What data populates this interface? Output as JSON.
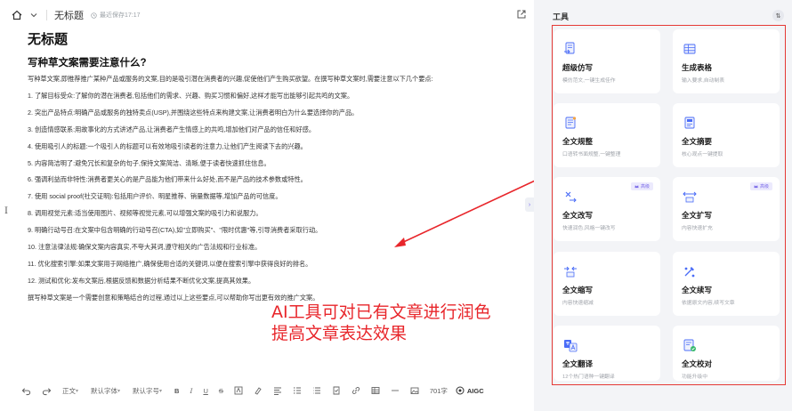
{
  "topbar": {
    "doc_title": "无标题",
    "save_status": "最近保存17:17"
  },
  "document": {
    "heading": "无标题",
    "subheading": "写种草文案需要注意什么?",
    "intro": "写种草文案,即推荐推广某种产品或服务的文案,目的是吸引潜在消费者的兴趣,促使他们产生购买欲望。在撰写种草文案时,需要注意以下几个要点:",
    "items": [
      "1. 了解目标受众:了解你的潜在消费者,包括他们的需求、兴趣、购买习惯和偏好,这样才能写出能够引起共鸣的文案。",
      "2. 突出产品特点:明确产品或服务的独特卖点(USP),并围绕这些特点来构建文案,让消费者明白为什么要选择你的产品。",
      "3. 创造情感联系:用故事化的方式讲述产品,让消费者产生情感上的共鸣,增加他们对产品的信任和好感。",
      "4. 使用吸引人的标题:一个吸引人的标题可以有效地吸引读者的注意力,让他们产生阅读下去的兴趣。",
      "5. 内容简洁明了:避免冗长和复杂的句子,保持文案简洁、清晰,便于读者快速抓住信息。",
      "6. 强调利益而非特性:消费者更关心的是产品能为他们带来什么好处,而不是产品的技术参数或特性。",
      "7. 使用 social proof(社交证明):包括用户评价、明星推荐、销量数据等,增加产品的可信度。",
      "8. 调用视觉元素:适当使用图片、视频等视觉元素,可以增强文案的吸引力和说服力。",
      "9. 明确行动号召:在文案中包含明确的行动号召(CTA),如\"立即购买\"、\"限时优惠\"等,引导消费者采取行动。",
      "10. 注意法律法规:确保文案内容真实,不夸大其词,遵守相关的广告法规和行业标准。",
      "11. 优化搜索引擎:如果文案用于网络推广,确保使用合适的关键词,以便在搜索引擎中获得良好的排名。",
      "12. 测试和优化:发布文案后,根据反馈和数据分析结果不断优化文案,提高其效果。"
    ],
    "outro": "撰写种草文案是一个需要创意和策略结合的过程,通过以上这些要点,可以帮助你写出更有效的推广文案。"
  },
  "annotation": {
    "line1": "AI工具可对已有文章进行润色",
    "line2": "提高文章表达效果"
  },
  "editor_toolbar": {
    "paragraph_style": "正文",
    "font_family": "默认字体",
    "font_size": "默认字号",
    "word_count": "701字",
    "aigc_label": "AIGC"
  },
  "tools_panel": {
    "title": "工具",
    "cards": [
      {
        "name": "超级仿写",
        "desc": "模仿范文,一键生成佳作",
        "icon": "super-rewrite-icon",
        "badge": ""
      },
      {
        "name": "生成表格",
        "desc": "输入要求,自动制表",
        "icon": "table-icon",
        "badge": ""
      },
      {
        "name": "全文规整",
        "desc": "口语转书面规整,一键整理",
        "icon": "tidy-icon",
        "badge": ""
      },
      {
        "name": "全文摘要",
        "desc": "核心观点一键提取",
        "icon": "summary-icon",
        "badge": ""
      },
      {
        "name": "全文改写",
        "desc": "快速润色,风格一键改写",
        "icon": "rewrite-icon",
        "badge": "高级"
      },
      {
        "name": "全文扩写",
        "desc": "内容快速扩充",
        "icon": "expand-icon",
        "badge": "高级"
      },
      {
        "name": "全文缩写",
        "desc": "内容快速缩减",
        "icon": "shrink-icon",
        "badge": ""
      },
      {
        "name": "全文续写",
        "desc": "依据原文内容,续写文章",
        "icon": "continue-icon",
        "badge": ""
      },
      {
        "name": "全文翻译",
        "desc": "12个热门语种一键翻译",
        "icon": "translate-icon",
        "badge": ""
      },
      {
        "name": "全文校对",
        "desc": "功能升级中",
        "icon": "proofread-icon",
        "badge": ""
      }
    ]
  },
  "colors": {
    "accent": "#4a6cf7",
    "badge": "#7a6ae8",
    "annotation": "#e8262b",
    "panel_bg": "#f3f4f7"
  }
}
